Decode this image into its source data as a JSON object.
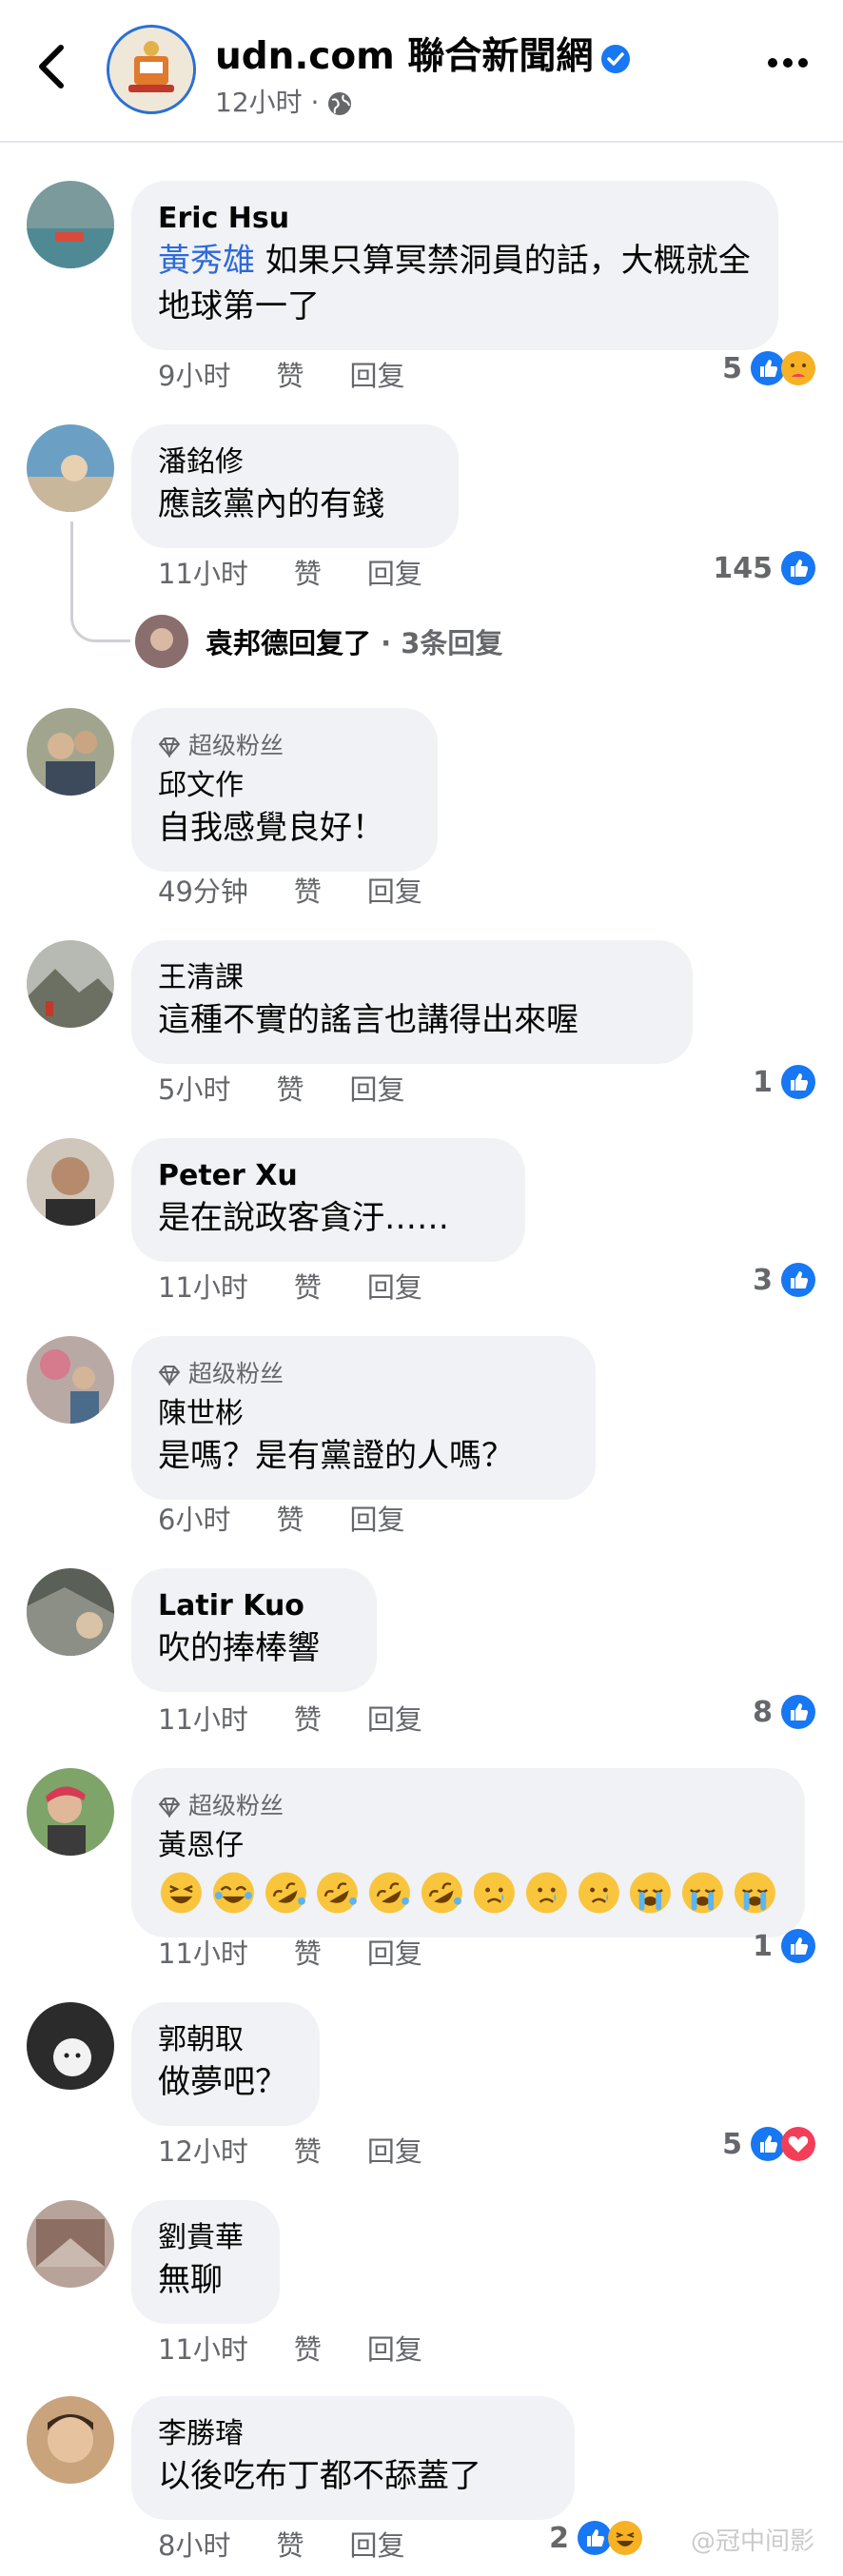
{
  "header": {
    "page_name": "udn.com 聯合新聞網",
    "time": "12小时 ·",
    "icons": [
      "back-arrow-icon",
      "verified-badge-icon",
      "globe-icon",
      "more-icon"
    ]
  },
  "actions": {
    "like": "赞",
    "reply": "回复"
  },
  "comments": [
    {
      "author": "Eric Hsu",
      "mention": "黃秀雄",
      "text": " 如果只算冥禁洞員的話，大概就全地球第一了",
      "time": "9小时",
      "reactions": "5",
      "reaction_icons": [
        "like",
        "care"
      ]
    },
    {
      "author": "潘銘修",
      "text": "應該黨內的有錢",
      "time": "11小时",
      "reactions": "145",
      "reaction_icons": [
        "like"
      ],
      "reply_summary": {
        "name": "袁邦德回复了",
        "count": " · 3条回复"
      }
    },
    {
      "badge": "超级粉丝",
      "author": "邱文作",
      "text": "自我感覺良好！",
      "time": "49分钟",
      "reactions": "",
      "reaction_icons": []
    },
    {
      "author": "王清課",
      "text": "這種不實的謠言也講得出來喔",
      "time": "5小时",
      "reactions": "1",
      "reaction_icons": [
        "like"
      ]
    },
    {
      "author": "Peter Xu",
      "text": "是在說政客貪汙……",
      "time": "11小时",
      "reactions": "3",
      "reaction_icons": [
        "like"
      ]
    },
    {
      "badge": "超级粉丝",
      "author": "陳世彬",
      "text": "是嗎？是有黨證的人嗎？",
      "time": "6小时",
      "reactions": "",
      "reaction_icons": []
    },
    {
      "author": "Latir Kuo",
      "text": "吹的捧棒響",
      "time": "11小时",
      "reactions": "8",
      "reaction_icons": [
        "like"
      ]
    },
    {
      "badge": "超级粉丝",
      "author": "黃恩仔",
      "text": "",
      "time": "11小时",
      "reactions": "1",
      "reaction_icons": [
        "like"
      ],
      "emojis": [
        "laughing",
        "joy",
        "rofl",
        "rofl",
        "rofl",
        "rofl",
        "crying-face",
        "crying-face",
        "crying-face",
        "loudly-crying",
        "loudly-crying",
        "loudly-crying"
      ]
    },
    {
      "author": "郭朝取",
      "text": "做夢吧？",
      "time": "12小时",
      "reactions": "5",
      "reaction_icons": [
        "like",
        "love"
      ]
    },
    {
      "author": "劉貴華",
      "text": "無聊",
      "time": "11小时",
      "reactions": "",
      "reaction_icons": []
    },
    {
      "author": "李勝璿",
      "text": "以後吃布丁都不舔蓋了",
      "time": "8小时",
      "reactions": "2",
      "reaction_icons": [
        "like",
        "haha"
      ]
    }
  ],
  "watermark": "@冠中间影",
  "colors": {
    "link_blue": "#2d6ad8",
    "like_blue": "#1877f2",
    "love_red": "#f33e58",
    "bubble": "#f0f2f5",
    "meta_gray": "#65676b"
  }
}
